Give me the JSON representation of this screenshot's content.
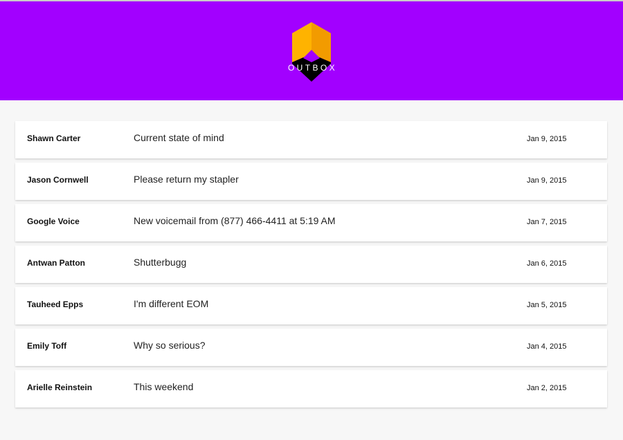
{
  "app": {
    "logo_text": "OUTBOX",
    "brand_color": "#a200ff",
    "logo_colors": [
      "#ffb300",
      "#f29b00",
      "#000000"
    ]
  },
  "messages": [
    {
      "sender": "Shawn Carter",
      "subject": "Current state of mind",
      "date": "Jan 9, 2015"
    },
    {
      "sender": "Jason Cornwell",
      "subject": "Please return my stapler",
      "date": "Jan 9, 2015"
    },
    {
      "sender": "Google Voice",
      "subject": "New voicemail from (877) 466-4411 at 5:19 AM",
      "date": "Jan 7, 2015"
    },
    {
      "sender": "Antwan Patton",
      "subject": "Shutterbugg",
      "date": "Jan 6, 2015"
    },
    {
      "sender": "Tauheed Epps",
      "subject": "I'm different EOM",
      "date": "Jan 5, 2015"
    },
    {
      "sender": "Emily Toff",
      "subject": "Why so serious?",
      "date": "Jan 4, 2015"
    },
    {
      "sender": "Arielle Reinstein",
      "subject": "This weekend",
      "date": "Jan 2, 2015"
    }
  ]
}
